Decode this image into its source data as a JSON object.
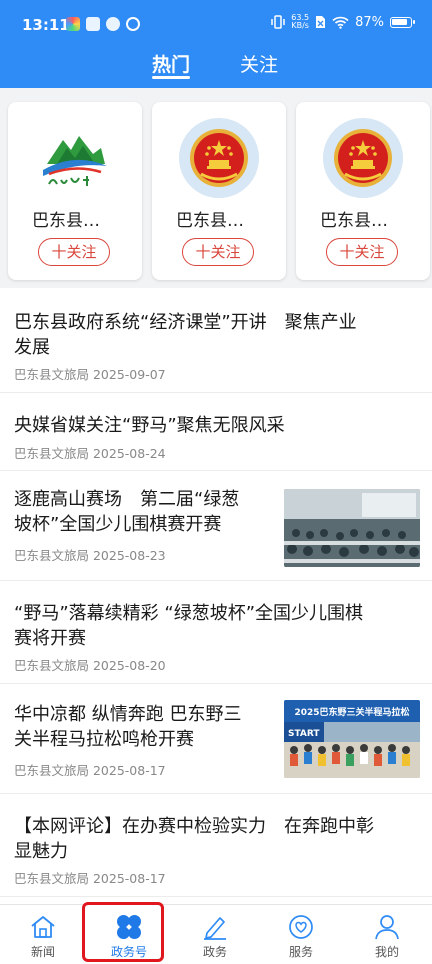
{
  "status_bar": {
    "time": "13:11",
    "speed_value": "63.5",
    "speed_unit": "KB/s",
    "battery": "87%"
  },
  "tabs": [
    {
      "label": "热门",
      "active": true
    },
    {
      "label": "关注",
      "active": false
    }
  ],
  "recommended": [
    {
      "name": "巴东县…",
      "follow_label": "十关注",
      "logo": "badong-tourism-logo"
    },
    {
      "name": "巴东县…",
      "follow_label": "十关注",
      "logo": "national-emblem"
    },
    {
      "name": "巴东县…",
      "follow_label": "十关注",
      "logo": "national-emblem"
    }
  ],
  "news": [
    {
      "title_line1": "巴东县政府系统“经济课堂”开讲　聚焦产业",
      "title_line2": "发展",
      "meta": "巴东县文旅局 2025-09-07",
      "has_thumb": false
    },
    {
      "title_line1": "央媒省媒关注“野马”聚焦无限风采",
      "title_line2": "",
      "meta": "巴东县文旅局 2025-08-24",
      "has_thumb": false
    },
    {
      "title_line1": "逐鹿高山赛场　第二届“绿葱",
      "title_line2": "坡杯”全国少儿围棋赛开赛",
      "meta": "巴东县文旅局 2025-08-23",
      "has_thumb": true
    },
    {
      "title_line1": "“野马”落幕续精彩 “绿葱坡杯”全国少儿围棋",
      "title_line2": "赛将开赛",
      "meta": "巴东县文旅局 2025-08-20",
      "has_thumb": false
    },
    {
      "title_line1": "华中凉都 纵情奔跑 巴东野三",
      "title_line2": "关半程马拉松鸣枪开赛",
      "meta": "巴东县文旅局 2025-08-17",
      "has_thumb": true
    },
    {
      "title_line1": "【本网评论】在办赛中检验实力　在奔跑中彰",
      "title_line2": "显魅力",
      "meta": "巴东县文旅局 2025-08-17",
      "has_thumb": false
    }
  ],
  "thumb_text": {
    "marathon_banner": "2025巴东野三关半程马拉松",
    "marathon_start": "START"
  },
  "bottom_nav": [
    {
      "label": "新闻",
      "icon": "house-icon",
      "active": false
    },
    {
      "label": "政务号",
      "icon": "clover-icon",
      "active": true
    },
    {
      "label": "政务",
      "icon": "pen-icon",
      "active": false
    },
    {
      "label": "服务",
      "icon": "heart-hand-icon",
      "active": false
    },
    {
      "label": "我的",
      "icon": "user-icon",
      "active": false
    }
  ],
  "colors": {
    "header_blue": "#2f8bf5",
    "follow_red": "#d9463b",
    "nav_active": "#1f7ae8",
    "highlight_red": "#e0171d"
  }
}
